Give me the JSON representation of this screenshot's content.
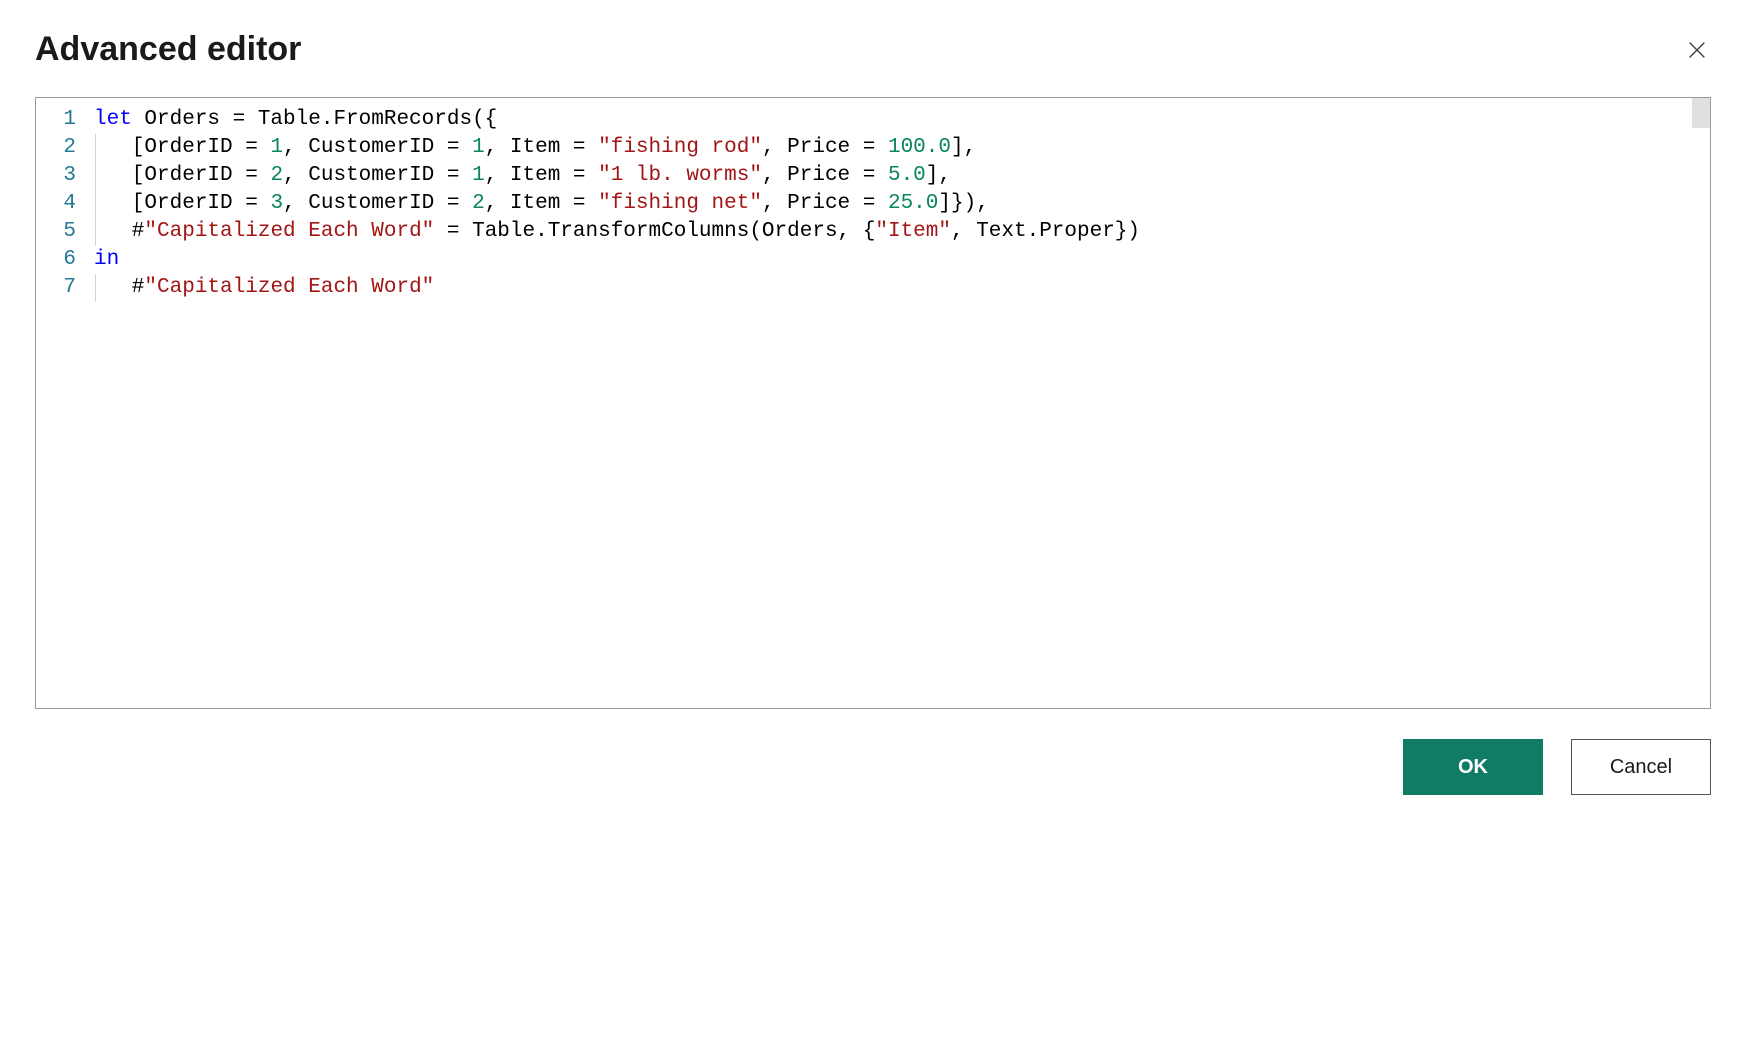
{
  "header": {
    "title": "Advanced editor"
  },
  "editor": {
    "lineNumbers": [
      "1",
      "2",
      "3",
      "4",
      "5",
      "6",
      "7"
    ],
    "lines": [
      {
        "tokens": [
          {
            "t": "kw",
            "v": "let"
          },
          {
            "t": "ident",
            "v": " Orders = Table.FromRecords({"
          }
        ]
      },
      {
        "indent": 1,
        "tokens": [
          {
            "t": "ident",
            "v": "   [OrderID = "
          },
          {
            "t": "num",
            "v": "1"
          },
          {
            "t": "ident",
            "v": ", CustomerID = "
          },
          {
            "t": "num",
            "v": "1"
          },
          {
            "t": "ident",
            "v": ", Item = "
          },
          {
            "t": "str",
            "v": "\"fishing rod\""
          },
          {
            "t": "ident",
            "v": ", Price = "
          },
          {
            "t": "num",
            "v": "100.0"
          },
          {
            "t": "ident",
            "v": "],"
          }
        ]
      },
      {
        "indent": 1,
        "tokens": [
          {
            "t": "ident",
            "v": "   [OrderID = "
          },
          {
            "t": "num",
            "v": "2"
          },
          {
            "t": "ident",
            "v": ", CustomerID = "
          },
          {
            "t": "num",
            "v": "1"
          },
          {
            "t": "ident",
            "v": ", Item = "
          },
          {
            "t": "str",
            "v": "\"1 lb. worms\""
          },
          {
            "t": "ident",
            "v": ", Price = "
          },
          {
            "t": "num",
            "v": "5.0"
          },
          {
            "t": "ident",
            "v": "],"
          }
        ]
      },
      {
        "indent": 1,
        "tokens": [
          {
            "t": "ident",
            "v": "   [OrderID = "
          },
          {
            "t": "num",
            "v": "3"
          },
          {
            "t": "ident",
            "v": ", CustomerID = "
          },
          {
            "t": "num",
            "v": "2"
          },
          {
            "t": "ident",
            "v": ", Item = "
          },
          {
            "t": "str",
            "v": "\"fishing net\""
          },
          {
            "t": "ident",
            "v": ", Price = "
          },
          {
            "t": "num",
            "v": "25.0"
          },
          {
            "t": "ident",
            "v": "]}),"
          }
        ]
      },
      {
        "indent": 1,
        "tokens": [
          {
            "t": "ident",
            "v": "   #"
          },
          {
            "t": "str",
            "v": "\"Capitalized Each Word\""
          },
          {
            "t": "ident",
            "v": " = Table.TransformColumns(Orders, {"
          },
          {
            "t": "str",
            "v": "\"Item\""
          },
          {
            "t": "ident",
            "v": ", Text.Proper})"
          }
        ]
      },
      {
        "tokens": [
          {
            "t": "kw",
            "v": "in"
          }
        ]
      },
      {
        "indent": 1,
        "tokens": [
          {
            "t": "ident",
            "v": "   #"
          },
          {
            "t": "str",
            "v": "\"Capitalized Each Word\""
          }
        ]
      }
    ]
  },
  "footer": {
    "ok_label": "OK",
    "cancel_label": "Cancel"
  }
}
